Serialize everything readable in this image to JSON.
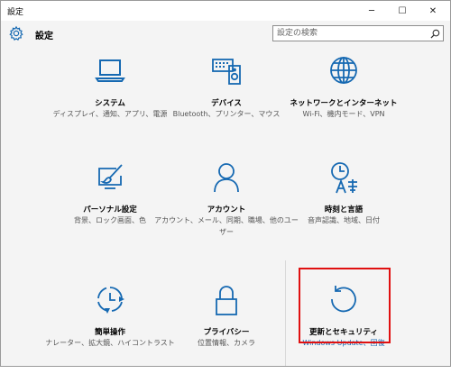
{
  "window": {
    "title": "設定",
    "minimize_glyph": "─",
    "maximize_glyph": "☐",
    "close_glyph": "✕"
  },
  "header": {
    "title": "設定",
    "search_placeholder": "設定の検索"
  },
  "accent_color": "#1669b2",
  "highlight_color": "#e01010",
  "tiles": [
    {
      "id": "system",
      "icon": "laptop-icon",
      "title": "システム",
      "desc": "ディスプレイ、通知、アプリ、電源"
    },
    {
      "id": "devices",
      "icon": "keyboard-speaker-icon",
      "title": "デバイス",
      "desc": "Bluetooth、プリンター、マウス"
    },
    {
      "id": "network",
      "icon": "globe-icon",
      "title": "ネットワークとインターネット",
      "desc": "Wi-Fi、機内モード、VPN"
    },
    {
      "id": "personalization",
      "icon": "paintbrush-monitor-icon",
      "title": "パーソナル設定",
      "desc": "背景、ロック画面、色"
    },
    {
      "id": "accounts",
      "icon": "person-icon",
      "title": "アカウント",
      "desc": "アカウント、メール、同期、職場、他のユーザー"
    },
    {
      "id": "time-language",
      "icon": "clock-language-icon",
      "title": "時刻と言語",
      "desc": "音声認識、地域、日付"
    },
    {
      "id": "ease-of-access",
      "icon": "ease-of-access-icon",
      "title": "簡単操作",
      "desc": "ナレーター、拡大鏡、ハイコントラスト"
    },
    {
      "id": "privacy",
      "icon": "lock-icon",
      "title": "プライバシー",
      "desc": "位置情報、カメラ"
    },
    {
      "id": "update-security",
      "icon": "refresh-icon",
      "title": "更新とセキュリティ",
      "desc": "Windows Update、回復"
    }
  ]
}
